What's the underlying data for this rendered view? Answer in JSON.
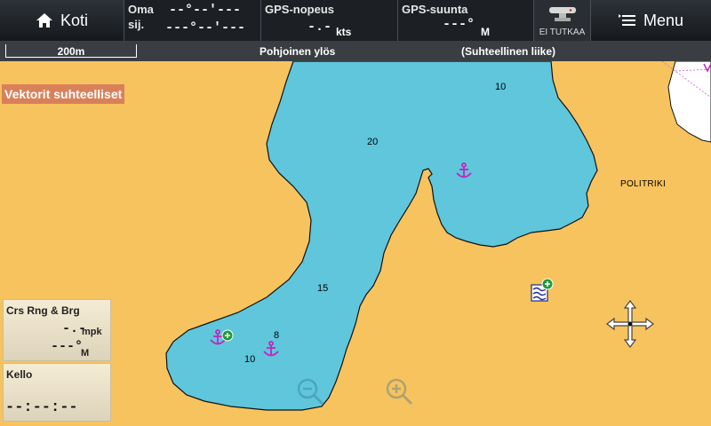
{
  "topbar": {
    "home_label": "Koti",
    "own_pos_label_1": "Oma",
    "own_pos_label_2": "sij.",
    "own_pos_lat": "--°--'---",
    "own_pos_lon": "---°--'---",
    "gps_speed_label": "GPS-nopeus",
    "gps_speed_value": "-.-",
    "gps_speed_unit": "kts",
    "gps_course_label": "GPS-suunta",
    "gps_course_value": "---°",
    "gps_course_unit": "M",
    "radar_label": "EI TUTKAA",
    "menu_label": "Menu"
  },
  "statusbar": {
    "scale": "200m",
    "orientation": "Pohjoinen ylös",
    "motion": "(Suhteellinen liike)"
  },
  "vectors_label": "Vektorit suhteelliset",
  "map": {
    "depths": [
      "10",
      "20",
      "15",
      "8",
      "10"
    ],
    "place_name": "POLITRIKI",
    "water_color": "#5fc6dc",
    "land_color": "#f7c35f"
  },
  "crs_box": {
    "title": "Crs Rng & Brg",
    "range_value": "-.-",
    "range_unit": "mpk",
    "bearing_value": "---°",
    "bearing_unit": "M"
  },
  "clock_box": {
    "title": "Kello",
    "value": "--:--:--"
  },
  "icons": [
    "home-icon",
    "radar-icon",
    "menu-icon",
    "anchorage-icon",
    "buoy-icon",
    "pan-cross-icon",
    "zoom-out-icon",
    "zoom-in-icon"
  ]
}
